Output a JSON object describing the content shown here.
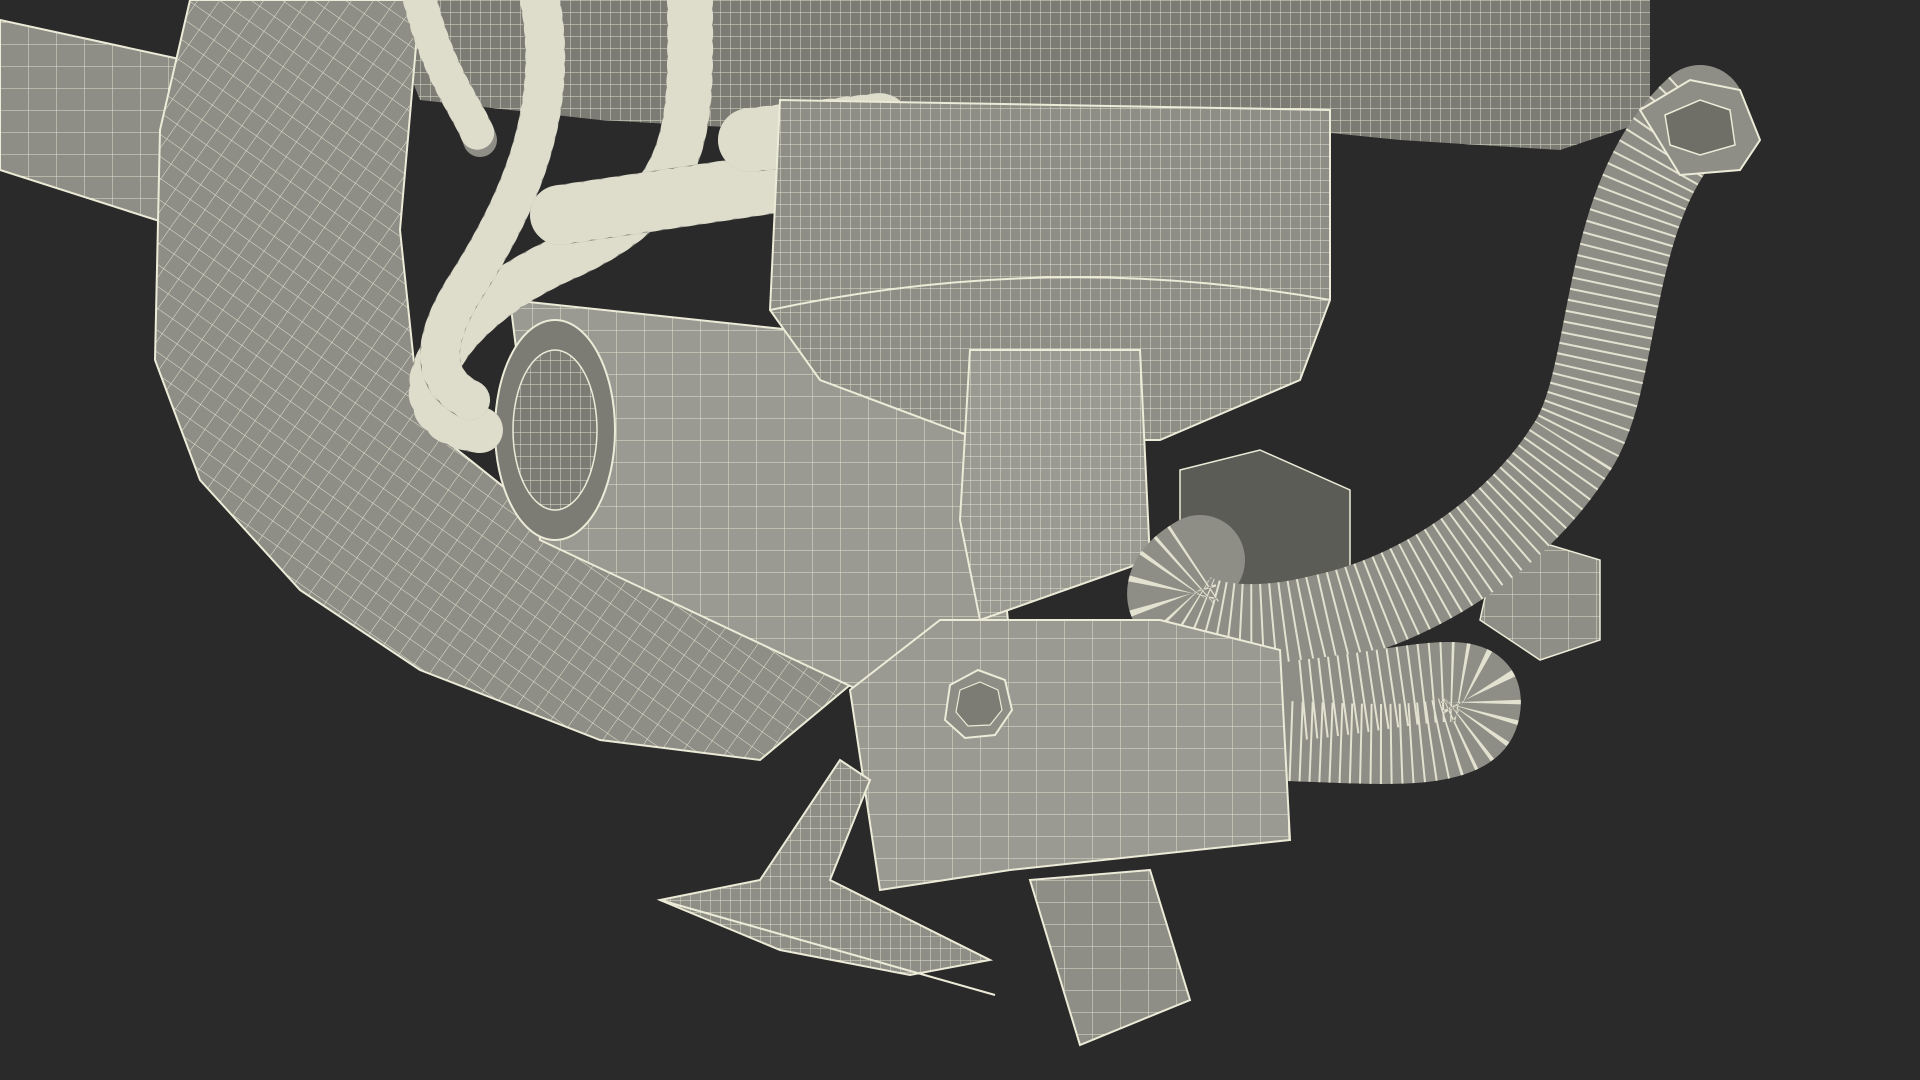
{
  "scene": {
    "subject": "engine-wireframe-render",
    "background_color": "#2a2a2a",
    "surface_color": "#8e8e86",
    "surface_dark": "#6f6f68",
    "surface_light": "#a3a39b",
    "wire_color": "#ecebd8"
  }
}
